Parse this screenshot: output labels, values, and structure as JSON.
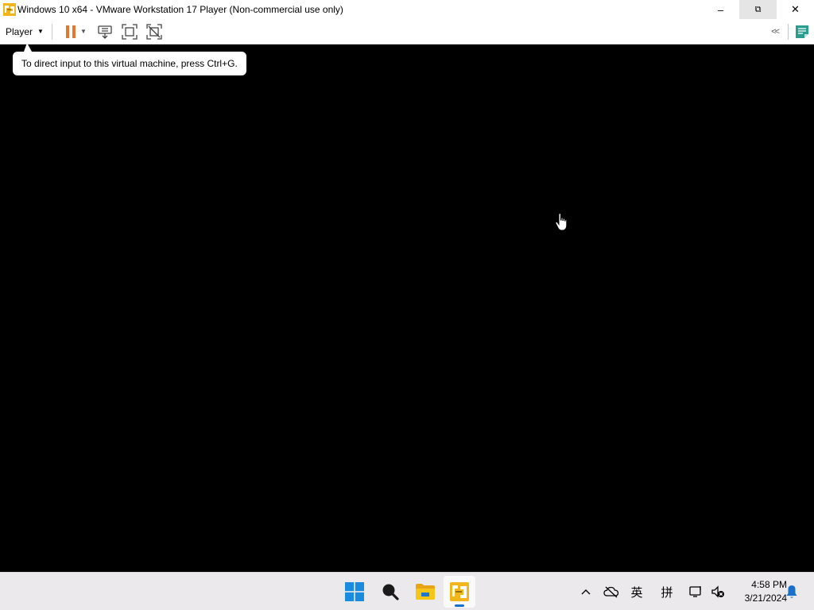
{
  "window": {
    "title": "Windows 10 x64 - VMware Workstation 17 Player (Non-commercial use only)",
    "minimize_glyph": "–",
    "restore_glyph": "⧉",
    "close_glyph": "✕"
  },
  "toolbar": {
    "player_menu_label": "Player",
    "caret_glyph": "▼",
    "dropdown_glyph": "▼",
    "collapse_glyph": "<<",
    "icons": [
      "pause-icon",
      "send-ctrl-alt-del-icon",
      "full-screen-icon",
      "unity-icon",
      "notes-icon"
    ]
  },
  "vm": {
    "tooltip_text": "To direct input to this virtual machine, press Ctrl+G."
  },
  "taskbar": {
    "apps": [
      "windows-start-icon",
      "search-icon",
      "file-explorer-icon",
      "vmware-player-icon"
    ],
    "tray": {
      "chevron_glyph": "^",
      "ime_lang": "英",
      "ime_mode": "拼"
    },
    "clock_time": "4:58 PM",
    "clock_date": "3/21/2024"
  },
  "colors": {
    "accent_orange": "#e8772e",
    "vm_background": "#000000",
    "taskbar_bg": "#ece9ed",
    "windows_blue": "#1a8ce0",
    "folder_yellow": "#f5c518",
    "notes_green": "#2a9d8f"
  }
}
